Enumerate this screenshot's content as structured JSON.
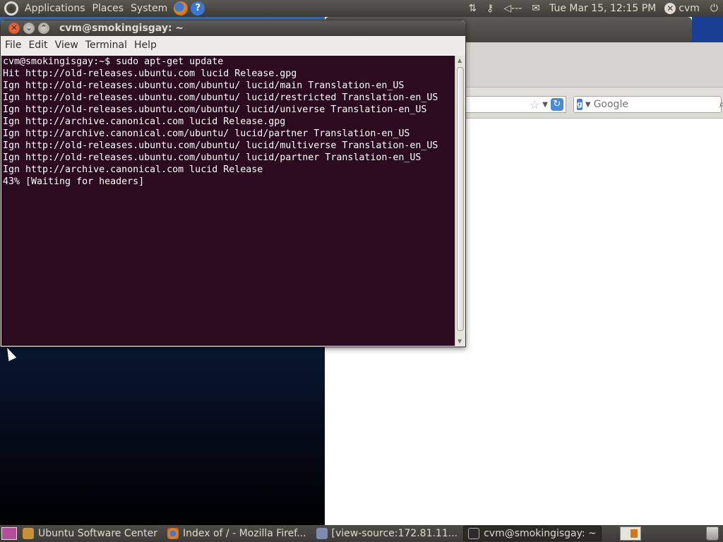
{
  "top_panel": {
    "menus": [
      "Applications",
      "Places",
      "System"
    ],
    "clock": "Tue Mar 15, 12:15 PM",
    "user": "cvm",
    "icons": [
      "ubuntu-logo-icon",
      "firefox-icon",
      "help-icon",
      "network-arrows-icon",
      "key-icon",
      "volume-icon",
      "mail-icon",
      "user-status-icon",
      "power-icon"
    ]
  },
  "browser": {
    "search_placeholder": "Google"
  },
  "terminal": {
    "title": "cvm@smokingisgay: ~",
    "menu": [
      "File",
      "Edit",
      "View",
      "Terminal",
      "Help"
    ],
    "lines": [
      "cvm@smokingisgay:~$ sudo apt-get update",
      "Hit http://old-releases.ubuntu.com lucid Release.gpg",
      "Ign http://old-releases.ubuntu.com/ubuntu/ lucid/main Translation-en_US",
      "Ign http://old-releases.ubuntu.com/ubuntu/ lucid/restricted Translation-en_US",
      "Ign http://old-releases.ubuntu.com/ubuntu/ lucid/universe Translation-en_US",
      "Ign http://archive.canonical.com lucid Release.gpg",
      "Ign http://archive.canonical.com/ubuntu/ lucid/partner Translation-en_US",
      "Ign http://old-releases.ubuntu.com/ubuntu/ lucid/multiverse Translation-en_US",
      "Ign http://old-releases.ubuntu.com/ubuntu/ lucid/partner Translation-en_US",
      "Ign http://archive.canonical.com lucid Release",
      "43% [Waiting for headers]"
    ]
  },
  "taskbar": {
    "tasks": [
      {
        "label": "Ubuntu Software Center",
        "icon": "software-center-icon"
      },
      {
        "label": "Index of / - Mozilla Firef...",
        "icon": "firefox-icon"
      },
      {
        "label": "[view-source:172.81.11...",
        "icon": "web-page-icon"
      },
      {
        "label": "cvm@smokingisgay: ~",
        "icon": "terminal-icon"
      }
    ]
  },
  "colors": {
    "terminal_bg": "#2c0a1f",
    "panel_bg": "#3d3c37",
    "panel_text": "#dfdbd2"
  }
}
